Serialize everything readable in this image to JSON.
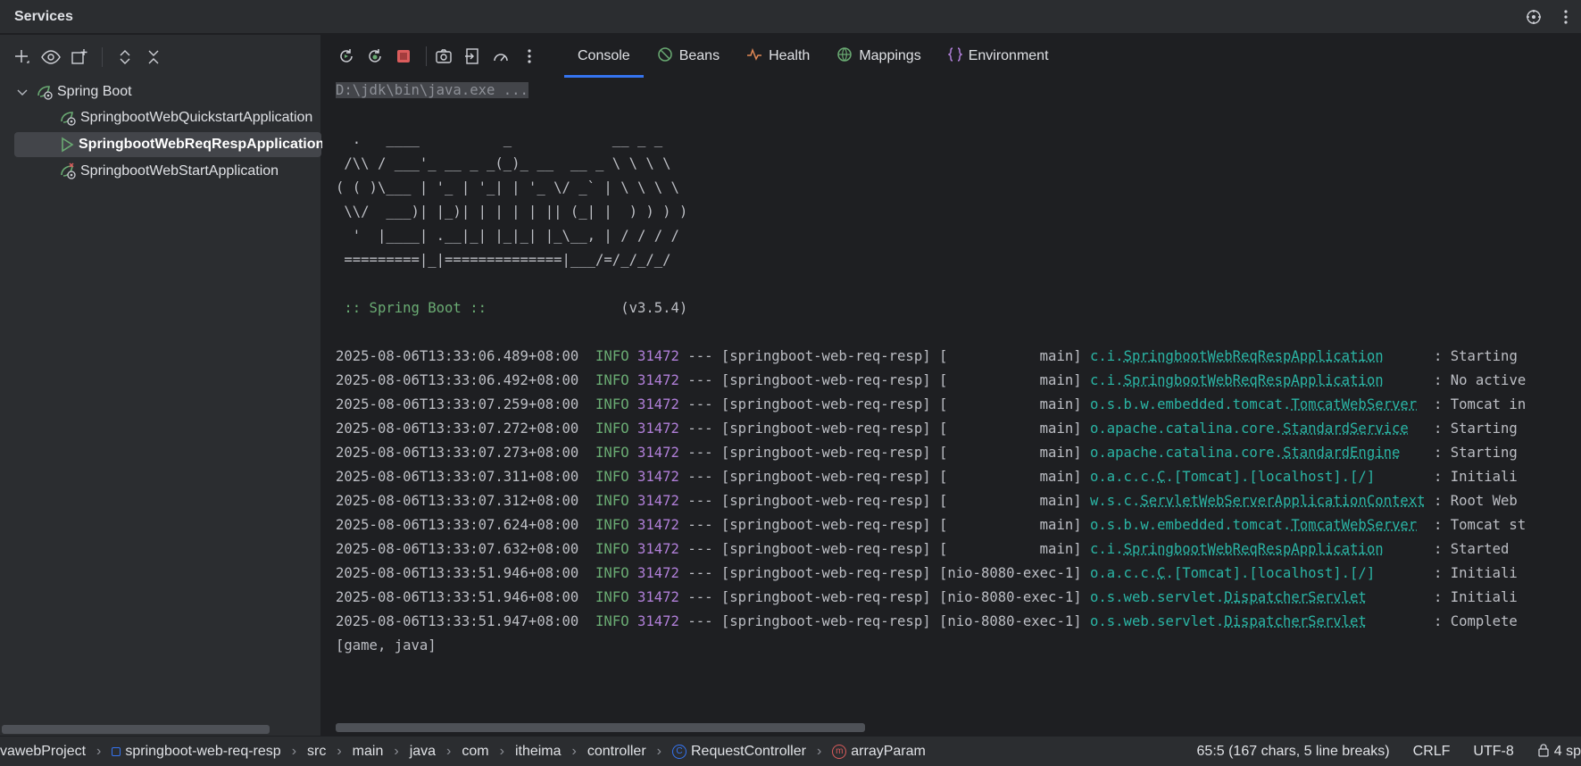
{
  "window": {
    "title": "Services"
  },
  "left": {
    "tree": {
      "root": "Spring Boot",
      "items": [
        {
          "label": "SpringbootWebQuickstartApplication"
        },
        {
          "label": "SpringbootWebReqRespApplication"
        },
        {
          "label": "SpringbootWebStartApplication"
        }
      ]
    }
  },
  "tabs": [
    {
      "label": "Console",
      "icon": "console"
    },
    {
      "label": "Beans",
      "icon": "beans-icon"
    },
    {
      "label": "Health",
      "icon": "health-icon"
    },
    {
      "label": "Mappings",
      "icon": "mappings-icon"
    },
    {
      "label": "Environment",
      "icon": "environment-icon"
    }
  ],
  "console": {
    "command": "D:\\jdk\\bin\\java.exe ...",
    "banner": [
      "  .   ____          _            __ _ _",
      " /\\\\ / ___'_ __ _ _(_)_ __  __ _ \\ \\ \\ \\",
      "( ( )\\___ | '_ | '_| | '_ \\/ _` | \\ \\ \\ \\",
      " \\\\/  ___)| |_)| | | | | || (_| |  ) ) ) )",
      "  '  |____| .__|_| |_|_| |_\\__, | / / / /",
      " =========|_|==============|___/=/_/_/_/"
    ],
    "boot_label": " :: Spring Boot :: ",
    "boot_version": "               (v3.5.4)",
    "logs": [
      {
        "ts": "2025-08-06T13:33:06.489+08:00",
        "level": "INFO",
        "pid": "31472",
        "app": " --- [springboot-web-req-resp] [",
        "thread": "           main] ",
        "logger_prefix": "c.i.",
        "logger_class": "SpringbootWebReqRespApplication",
        "pad": "      ",
        "msg": ": Starting"
      },
      {
        "ts": "2025-08-06T13:33:06.492+08:00",
        "level": "INFO",
        "pid": "31472",
        "app": " --- [springboot-web-req-resp] [",
        "thread": "           main] ",
        "logger_prefix": "c.i.",
        "logger_class": "SpringbootWebReqRespApplication",
        "pad": "      ",
        "msg": ": No active"
      },
      {
        "ts": "2025-08-06T13:33:07.259+08:00",
        "level": "INFO",
        "pid": "31472",
        "app": " --- [springboot-web-req-resp] [",
        "thread": "           main] ",
        "logger_prefix": "o.s.b.w.embedded.tomcat.",
        "logger_class": "TomcatWebServer",
        "pad": "  ",
        "msg": ": Tomcat in"
      },
      {
        "ts": "2025-08-06T13:33:07.272+08:00",
        "level": "INFO",
        "pid": "31472",
        "app": " --- [springboot-web-req-resp] [",
        "thread": "           main] ",
        "logger_prefix": "o.apache.catalina.core.",
        "logger_class": "StandardService",
        "pad": "   ",
        "msg": ": Starting"
      },
      {
        "ts": "2025-08-06T13:33:07.273+08:00",
        "level": "INFO",
        "pid": "31472",
        "app": " --- [springboot-web-req-resp] [",
        "thread": "           main] ",
        "logger_prefix": "o.apache.catalina.core.",
        "logger_class": "StandardEngine",
        "pad": "    ",
        "msg": ": Starting"
      },
      {
        "ts": "2025-08-06T13:33:07.311+08:00",
        "level": "INFO",
        "pid": "31472",
        "app": " --- [springboot-web-req-resp] [",
        "thread": "           main] ",
        "logger_prefix": "o.a.c.c.",
        "logger_class": "C",
        "pad": ".[Tomcat].[localhost].[/]       ",
        "msg": ": Initiali"
      },
      {
        "ts": "2025-08-06T13:33:07.312+08:00",
        "level": "INFO",
        "pid": "31472",
        "app": " --- [springboot-web-req-resp] [",
        "thread": "           main] ",
        "logger_prefix": "w.s.c.",
        "logger_class": "ServletWebServerApplicationContext",
        "pad": " ",
        "msg": ": Root Web"
      },
      {
        "ts": "2025-08-06T13:33:07.624+08:00",
        "level": "INFO",
        "pid": "31472",
        "app": " --- [springboot-web-req-resp] [",
        "thread": "           main] ",
        "logger_prefix": "o.s.b.w.embedded.tomcat.",
        "logger_class": "TomcatWebServer",
        "pad": "  ",
        "msg": ": Tomcat st"
      },
      {
        "ts": "2025-08-06T13:33:07.632+08:00",
        "level": "INFO",
        "pid": "31472",
        "app": " --- [springboot-web-req-resp] [",
        "thread": "           main] ",
        "logger_prefix": "c.i.",
        "logger_class": "SpringbootWebReqRespApplication",
        "pad": "      ",
        "msg": ": Started"
      },
      {
        "ts": "2025-08-06T13:33:51.946+08:00",
        "level": "INFO",
        "pid": "31472",
        "app": " --- [springboot-web-req-resp] [",
        "thread": "nio-8080-exec-1] ",
        "logger_prefix": "o.a.c.c.",
        "logger_class": "C",
        "pad": ".[Tomcat].[localhost].[/]       ",
        "msg": ": Initiali"
      },
      {
        "ts": "2025-08-06T13:33:51.946+08:00",
        "level": "INFO",
        "pid": "31472",
        "app": " --- [springboot-web-req-resp] [",
        "thread": "nio-8080-exec-1] ",
        "logger_prefix": "o.s.web.servlet.",
        "logger_class": "DispatcherServlet",
        "pad": "        ",
        "msg": ": Initiali"
      },
      {
        "ts": "2025-08-06T13:33:51.947+08:00",
        "level": "INFO",
        "pid": "31472",
        "app": " --- [springboot-web-req-resp] [",
        "thread": "nio-8080-exec-1] ",
        "logger_prefix": "o.s.web.servlet.",
        "logger_class": "DispatcherServlet",
        "pad": "        ",
        "msg": ": Complete"
      }
    ],
    "output": "[game, java]"
  },
  "status": {
    "breadcrumbs": [
      "vawebProject",
      "springboot-web-req-resp",
      "src",
      "main",
      "java",
      "com",
      "itheima",
      "controller",
      "RequestController",
      "arrayParam"
    ],
    "position": "65:5 (167 chars, 5 line breaks)",
    "line_ending": "CRLF",
    "encoding": "UTF-8",
    "indent": "4 sp"
  },
  "colors": {
    "accent": "#3574f0",
    "info": "#6aab73",
    "pid": "#b07fd8",
    "logger": "#2ab5a5",
    "stop": "#db5c5c"
  }
}
